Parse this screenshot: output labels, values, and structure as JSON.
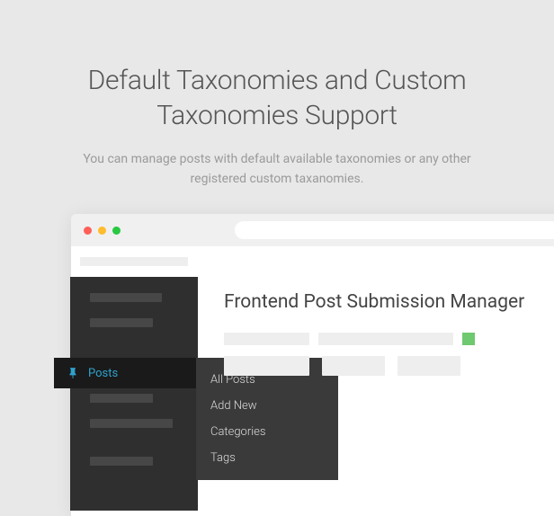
{
  "hero": {
    "title": "Default Taxonomies and Custom Taxonomies Support",
    "subtitle": "You can manage posts with default available taxonomies or any other registered custom taxanomies."
  },
  "sidebar": {
    "active_label": "Posts"
  },
  "submenu": {
    "items": [
      {
        "label": "All Posts"
      },
      {
        "label": "Add New"
      },
      {
        "label": "Categories"
      },
      {
        "label": "Tags"
      }
    ]
  },
  "content": {
    "title": "Frontend Post Submission Manager"
  }
}
